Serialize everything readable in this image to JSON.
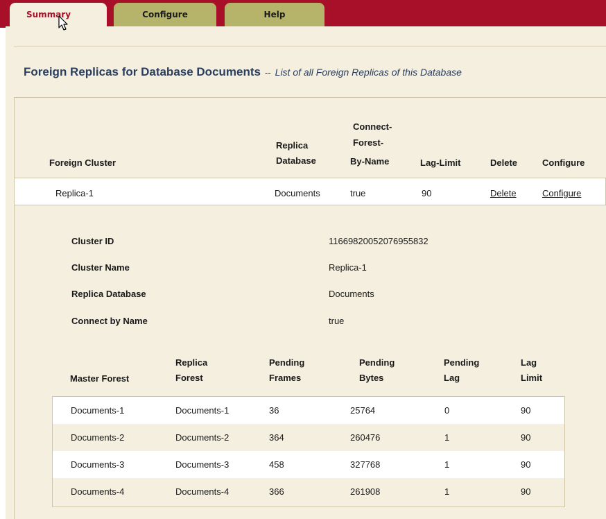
{
  "tabs": {
    "summary": "Summary",
    "configure": "Configure",
    "help": "Help"
  },
  "heading": {
    "title": "Foreign Replicas for Database Documents",
    "separator": "--",
    "description": "List of all Foreign Replicas of this Database"
  },
  "replica_table": {
    "headers": {
      "foreign_cluster": "Foreign Cluster",
      "replica_database_1": "Replica",
      "replica_database_2": "Database",
      "connect_1": "Connect-",
      "connect_2": "Forest-",
      "connect_3": "By-Name",
      "lag_limit": "Lag-Limit",
      "delete": "Delete",
      "configure": "Configure"
    },
    "row": {
      "foreign_cluster": "Replica-1",
      "replica_database": "Documents",
      "connect_by_name": "true",
      "lag_limit": "90",
      "delete": "Delete",
      "configure": "Configure"
    }
  },
  "details": {
    "cluster_id_label": "Cluster ID",
    "cluster_id_value": "11669820052076955832",
    "cluster_name_label": "Cluster Name",
    "cluster_name_value": "Replica-1",
    "replica_db_label": "Replica Database",
    "replica_db_value": "Documents",
    "connect_label": "Connect by Name",
    "connect_value": "true"
  },
  "forest_table": {
    "headers": {
      "master_forest": "Master Forest",
      "replica_forest_1": "Replica",
      "replica_forest_2": "Forest",
      "pending_frames_1": "Pending",
      "pending_frames_2": "Frames",
      "pending_bytes_1": "Pending",
      "pending_bytes_2": "Bytes",
      "pending_lag_1": "Pending",
      "pending_lag_2": "Lag",
      "lag_limit_1": "Lag",
      "lag_limit_2": "Limit"
    },
    "rows": [
      {
        "master": "Documents-1",
        "replica": "Documents-1",
        "frames": "36",
        "bytes": "25764",
        "lag": "0",
        "limit": "90"
      },
      {
        "master": "Documents-2",
        "replica": "Documents-2",
        "frames": "364",
        "bytes": "260476",
        "lag": "1",
        "limit": "90"
      },
      {
        "master": "Documents-3",
        "replica": "Documents-3",
        "frames": "458",
        "bytes": "327768",
        "lag": "1",
        "limit": "90"
      },
      {
        "master": "Documents-4",
        "replica": "Documents-4",
        "frames": "366",
        "bytes": "261908",
        "lag": "1",
        "limit": "90"
      }
    ]
  },
  "colors": {
    "topbar": "#a8102a",
    "panel": "#f4efdf",
    "tab_inactive": "#b5b46a",
    "heading": "#2a3e5e"
  }
}
